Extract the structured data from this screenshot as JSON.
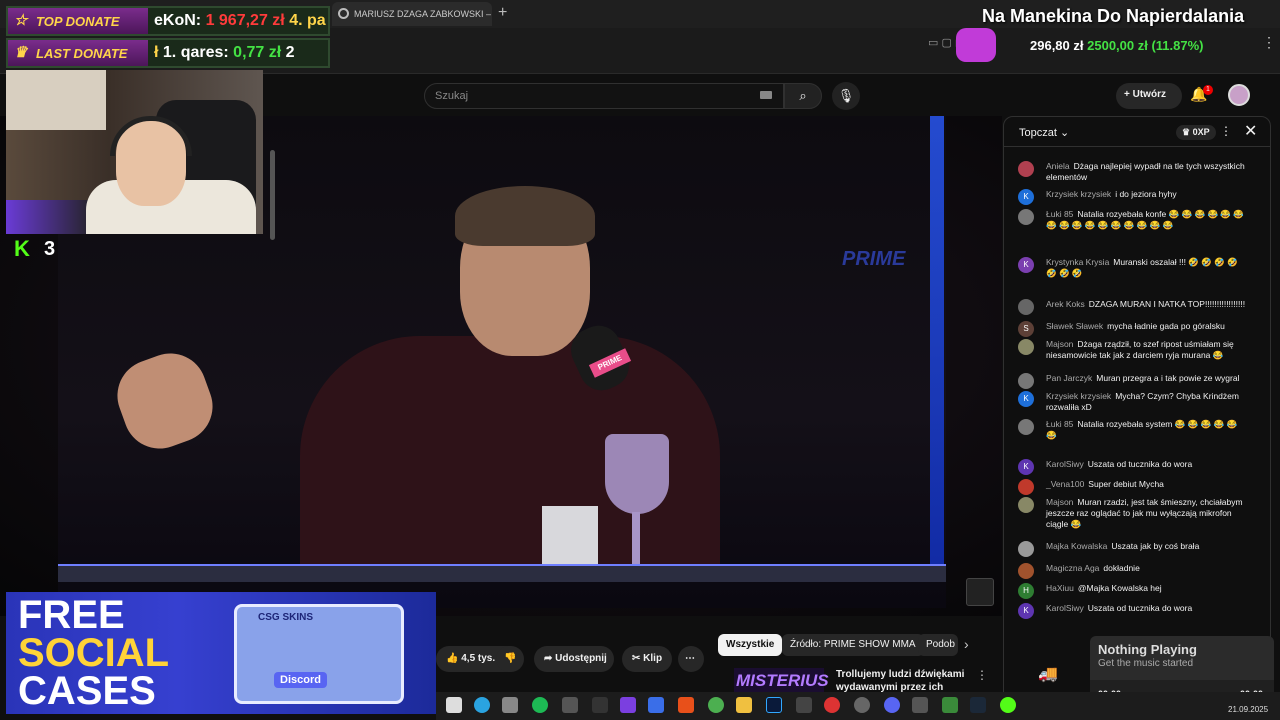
{
  "browser": {
    "tab_title": "MARIUSZ DZAGA ZABKOWSKI – Szuk",
    "new_tab": "+",
    "menu": "⋮"
  },
  "overlay": {
    "stream_title": "Na Manekina Do Napierdalania",
    "ticker_a": "296,80 zł",
    "ticker_b": "2500,00 zł",
    "ticker_c": "(11.87%)",
    "top_donate_label": "TOP DONATE",
    "top_donate_name": "eKoN:",
    "top_donate_amount": "1 967,27 zł",
    "top_donate_next": "4. pa",
    "last_donate_label": "LAST DONATE",
    "last_donate_prefix": "ł",
    "last_donate_name": "1. qares:",
    "last_donate_amount": "0,77 zł",
    "last_donate_next": "2",
    "kick_logo": "K",
    "kick_count": "3"
  },
  "header": {
    "search_placeholder": "Szukaj",
    "create_label": "Utwórz",
    "notif_count": "1"
  },
  "video": {
    "prime_logo": "PRIME",
    "mic_logo": "PRIME"
  },
  "ad": {
    "line1": "FREE",
    "line2": "SOCIAL",
    "line3": "CASES",
    "box_label": "CSG  SKINS",
    "discord": "Discord"
  },
  "actions": {
    "likes": "4,5 tys.",
    "share": "Udostępnij",
    "clip": "Klip",
    "more": "⋯"
  },
  "chips": [
    "Wszystkie",
    "Źródło: PRIME SHOW MMA",
    "Podob"
  ],
  "recommendation": {
    "thumb_text": "MISTERIUS",
    "title": "Trollujemy ludzi dźwiękami wydawanymi przez ich własne"
  },
  "chat": {
    "title": "Topczat",
    "xp": "0XP",
    "messages": [
      {
        "author": "Aniela",
        "text": "Dżaga najlepiej wypadł na tle tych wszystkich elementów",
        "initial": "",
        "color": "#b04050"
      },
      {
        "author": "Krzysiek krzysiek",
        "text": "i do jeziora hyhy",
        "initial": "K",
        "color": "#1e6fd9"
      },
      {
        "author": "Łuki 85",
        "text": "Natalia rozyebała konfe 😂 😂 😂 😂 😂 😂 😂 😂 😂 😂 😂 😂 😂 😂 😂 😂",
        "initial": "",
        "color": "#777"
      },
      {
        "author": "Krystynka Krysia",
        "text": "Muranski oszalał !!! 🤣 🤣 🤣 🤣 🤣 🤣 🤣",
        "initial": "K",
        "color": "#7b3fb0"
      },
      {
        "author": "Arek Koks",
        "text": "DZAGA MURAN I NATKA TOP!!!!!!!!!!!!!!!!!",
        "initial": "",
        "color": "#666"
      },
      {
        "author": "Sławek Sławek",
        "text": "mycha ładnie gada po góralsku",
        "initial": "S",
        "color": "#5d4037"
      },
      {
        "author": "Majson",
        "text": "Dżaga rządził, to szef ripost uśmiałam się niesamowicie tak jak z darciem ryja murana 😂",
        "initial": "",
        "color": "#886"
      },
      {
        "author": "Pan Jarczyk",
        "text": "Muran przegra a i tak powie ze wygral",
        "initial": "",
        "color": "#777"
      },
      {
        "author": "Krzysiek krzysiek",
        "text": "Mycha? Czym? Chyba Krindżem rozwaliła xD",
        "initial": "K",
        "color": "#1e6fd9"
      },
      {
        "author": "Łuki 85",
        "text": "Natalia rozyebała system 😂 😂 😂 😂 😂 😂",
        "initial": "",
        "color": "#777"
      },
      {
        "author": "KarolSiwy",
        "text": "Uszata od tucznika do wora",
        "initial": "K",
        "color": "#5e35b1"
      },
      {
        "author": "_Vena100",
        "text": "Super debiut Mycha",
        "initial": "",
        "color": "#c0392b"
      },
      {
        "author": "Majson",
        "text": "Muran rzadzi, jest tak śmieszny, chciałabym jeszcze raz oglądać to jak mu wyłączają mikrofon ciągle 😂",
        "initial": "",
        "color": "#886"
      },
      {
        "author": "Majka Kowalska",
        "text": "Uszata jak by coś brała",
        "initial": "",
        "color": "#999"
      },
      {
        "author": "Magiczna Aga",
        "text": "dokładnie",
        "initial": "",
        "color": "#a0522d"
      },
      {
        "author": "HaXiuu",
        "text": "@Majka Kowalska hej",
        "initial": "H",
        "color": "#2e7d32"
      },
      {
        "author": "KarolSiwy",
        "text": "Uszata od tucznika do wora",
        "initial": "K",
        "color": "#5e35b1"
      }
    ]
  },
  "player": {
    "title": "Nothing Playing",
    "subtitle": "Get the music started",
    "time_start": "00:00",
    "time_end": "00:00"
  },
  "taskbar": {
    "date": "21.09.2025"
  }
}
